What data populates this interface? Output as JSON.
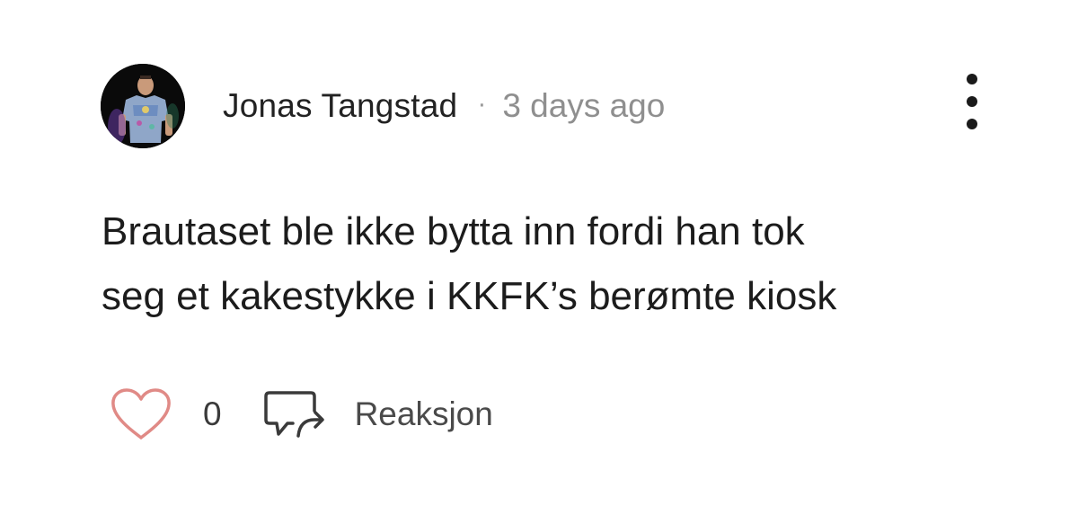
{
  "comment": {
    "author": "Jonas Tangstad",
    "separator": "·",
    "timestamp": "3 days ago",
    "text_lines": [
      "Brautaset ble ikke bytta inn fordi han tok",
      "seg et kakestykke i KKFK’s berømte kiosk"
    ],
    "like_count": "0",
    "reply_label": "Reaksjon"
  },
  "icons": {
    "avatar": "user-photo-avatar",
    "more": "more-vertical-icon",
    "like": "heart-outline-icon",
    "reply": "reply-bubble-icon"
  },
  "colors": {
    "heart": "#e08a86",
    "icon_stroke": "#3a3a3a",
    "muted_text": "#8f8f8f"
  }
}
